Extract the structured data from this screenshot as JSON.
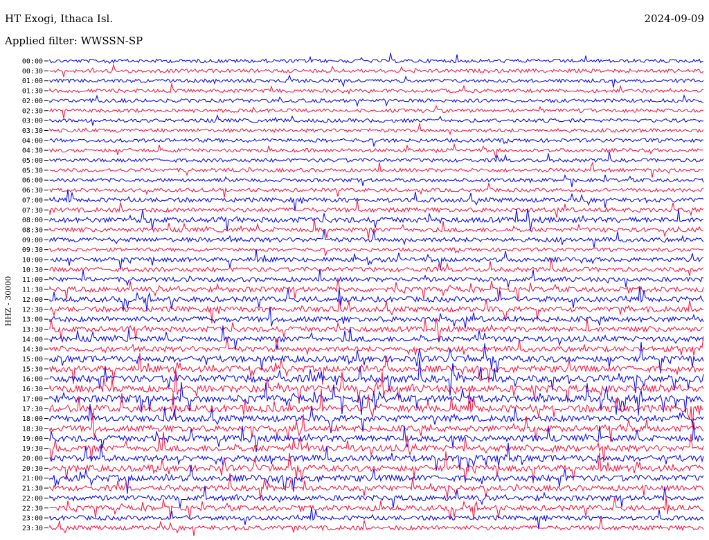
{
  "header": {
    "station": "HT Exogi, Ithaca Isl.",
    "filter": "Applied filter: WWSSN-SP",
    "date": "2024-09-09"
  },
  "channel_label": "HHZ - 30000",
  "colors": {
    "blue": "#1010e6",
    "red": "#f0204a"
  },
  "chart_data": {
    "type": "line",
    "title": "HT Exogi, Ithaca Isl.",
    "subtitle": "Applied filter: WWSSN-SP",
    "ylabel": "HHZ - 30000",
    "row_labels": [
      "00:00",
      "00:30",
      "01:00",
      "01:30",
      "02:00",
      "02:30",
      "03:00",
      "03:30",
      "04:00",
      "04:30",
      "05:00",
      "05:30",
      "06:00",
      "06:30",
      "07:00",
      "07:30",
      "08:00",
      "08:30",
      "09:00",
      "09:30",
      "10:00",
      "10:30",
      "11:00",
      "11:30",
      "12:00",
      "12:30",
      "13:00",
      "13:30",
      "14:00",
      "14:30",
      "15:00",
      "15:30",
      "16:00",
      "16:30",
      "17:00",
      "17:30",
      "18:00",
      "18:30",
      "19:00",
      "19:30",
      "20:00",
      "20:30",
      "21:00",
      "21:30",
      "22:00",
      "22:30",
      "23:00",
      "23:30"
    ],
    "row_colors": [
      "blue",
      "red"
    ],
    "activity_level": [
      1,
      1,
      1,
      1,
      1,
      1,
      1,
      1,
      1,
      1,
      1,
      1,
      1,
      1,
      2,
      2,
      3,
      2,
      2,
      1,
      2,
      2,
      2,
      3,
      3,
      3,
      3,
      3,
      3,
      3,
      4,
      4,
      5,
      5,
      5,
      5,
      4,
      4,
      4,
      4,
      4,
      4,
      4,
      3,
      3,
      3,
      2,
      2
    ],
    "grid": false,
    "legend": "none"
  }
}
